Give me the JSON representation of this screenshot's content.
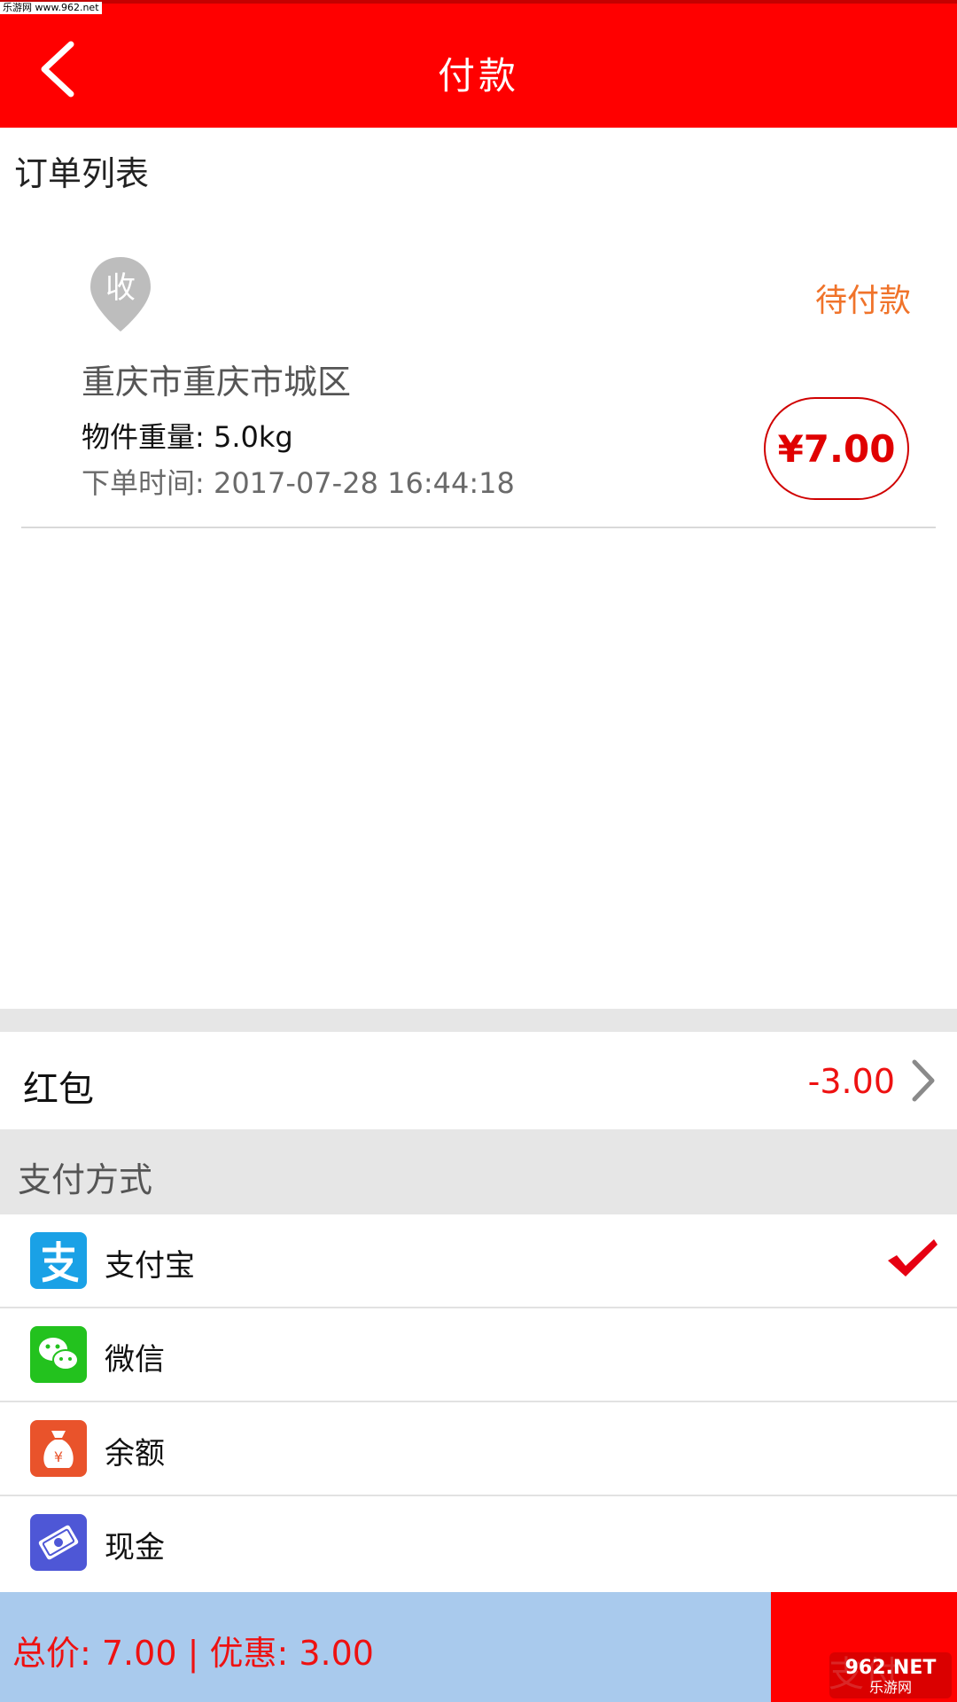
{
  "watermark": "乐游网 www.962.net",
  "header": {
    "title": "付款"
  },
  "order_section": {
    "title": "订单列表"
  },
  "order": {
    "pin_label": "收",
    "status": "待付款",
    "address": "重庆市重庆市城区",
    "weight": "物件重量: 5.0kg",
    "order_time": "下单时间: 2017-07-28 16:44:18",
    "price": "¥7.00"
  },
  "red_packet": {
    "label": "红包",
    "value": "-3.00"
  },
  "payment": {
    "header": "支付方式",
    "methods": [
      {
        "label": "支付宝",
        "icon": "alipay-icon",
        "color": "#1aa1e6",
        "selected": true
      },
      {
        "label": "微信",
        "icon": "wechat-icon",
        "color": "#23c21e",
        "selected": false
      },
      {
        "label": "余额",
        "icon": "money-bag-icon",
        "color": "#e9532b",
        "selected": false
      },
      {
        "label": "现金",
        "icon": "cash-icon",
        "color": "#4e57d6",
        "selected": false
      }
    ]
  },
  "footer": {
    "total": "总价: 7.00 | 优惠: 3.00",
    "pay_button": "支付",
    "brand_logo": "962.NET 乐游网"
  },
  "colors": {
    "primary": "#ff0000",
    "status_orange": "#f0732a",
    "footer_blue": "#a9caed",
    "section_gray": "#e6e6e6"
  }
}
